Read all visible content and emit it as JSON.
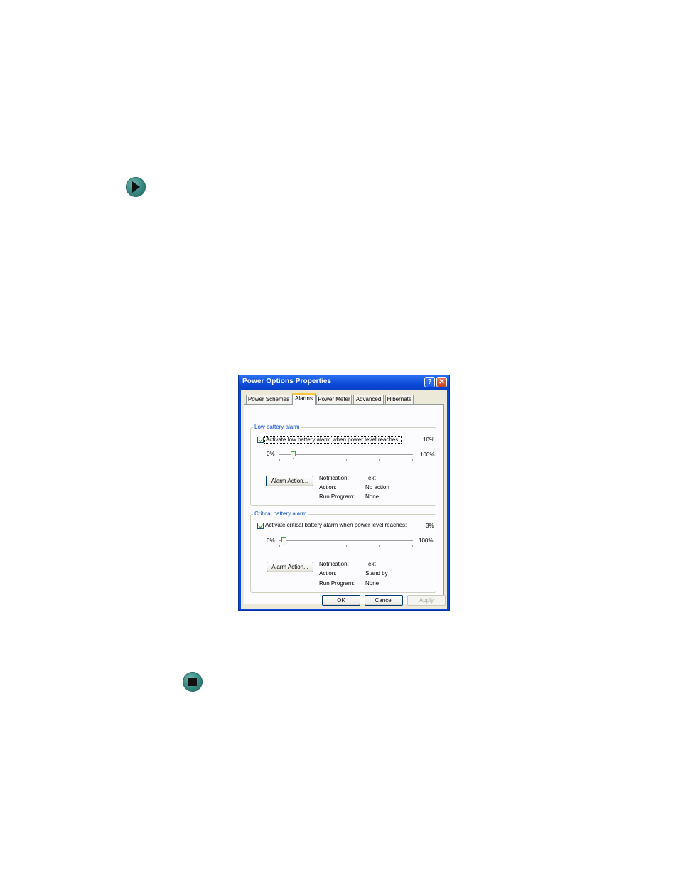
{
  "window": {
    "title": "Power Options Properties",
    "help_label": "?",
    "close_label": "✕"
  },
  "tabs": [
    {
      "label": "Power Schemes",
      "active": false
    },
    {
      "label": "Alarms",
      "active": true
    },
    {
      "label": "Power Meter",
      "active": false
    },
    {
      "label": "Advanced",
      "active": false
    },
    {
      "label": "Hibernate",
      "active": false
    }
  ],
  "low_battery": {
    "group_title": "Low battery alarm",
    "checkbox_label": "Activate low battery alarm when power level reaches:",
    "checked": true,
    "value_text": "10%",
    "level": 10,
    "min_label": "0%",
    "max_label": "100%",
    "action_button": "Alarm Action...",
    "notification_label": "Notification:",
    "notification_value": "Text",
    "action_label": "Action:",
    "action_value": "No action",
    "program_label": "Run Program:",
    "program_value": "None"
  },
  "critical_battery": {
    "group_title": "Critical battery alarm",
    "checkbox_label": "Activate critical battery alarm when power level reaches:",
    "checked": true,
    "value_text": "3%",
    "level": 3,
    "min_label": "0%",
    "max_label": "100%",
    "action_button": "Alarm Action...",
    "notification_label": "Notification:",
    "notification_value": "Text",
    "action_label": "Action:",
    "action_value": "Stand by",
    "program_label": "Run Program:",
    "program_value": "None"
  },
  "buttons": {
    "ok": "OK",
    "cancel": "Cancel",
    "apply": "Apply"
  },
  "icons": {
    "start_marker": "play-icon",
    "end_marker": "stop-icon"
  },
  "colors": {
    "titlebar": "#0a4ad8",
    "group_title": "#0046d5",
    "active_tab_accent": "#ffc83c"
  }
}
